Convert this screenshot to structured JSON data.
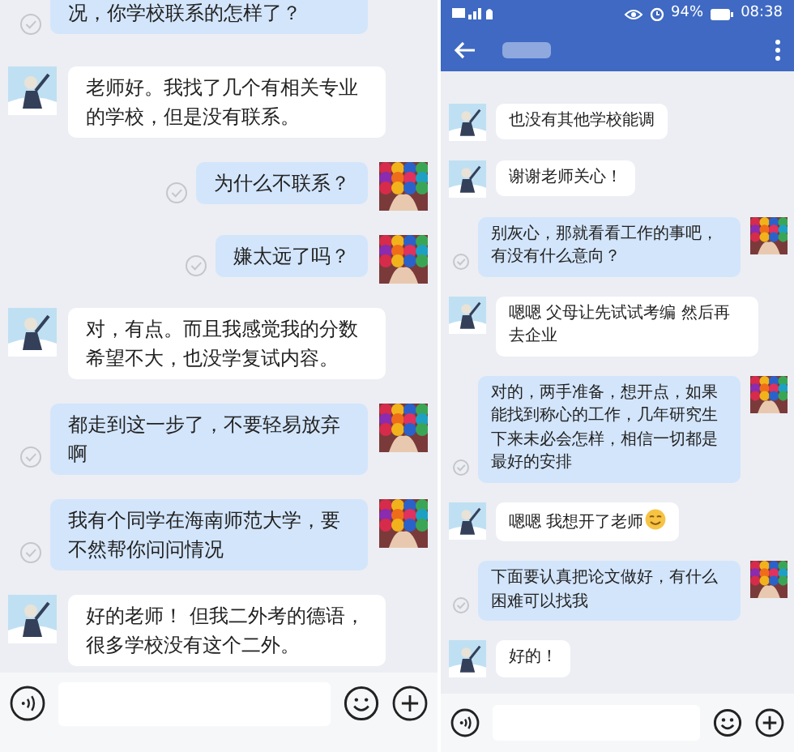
{
  "panels": [
    {
      "kind": "plain",
      "messages": [
        {
          "kind": "outgoing_cut",
          "read": true,
          "text": "况，你学校联系的怎样了？"
        },
        {
          "kind": "incoming",
          "read": false,
          "text": "老师好。我找了几个有相关专业的学校，但是没有联系。"
        },
        {
          "kind": "outgoing",
          "read": true,
          "text": "为什么不联系？"
        },
        {
          "kind": "outgoing",
          "read": true,
          "text": "嫌太远了吗？"
        },
        {
          "kind": "incoming",
          "read": false,
          "text": "对，有点。而且我感觉我的分数希望不大，也没学复试内容。"
        },
        {
          "kind": "outgoing",
          "read": true,
          "text": "都走到这一步了，不要轻易放弃啊"
        },
        {
          "kind": "outgoing",
          "read": true,
          "text": "我有个同学在海南师范大学，要不然帮你问问情况"
        },
        {
          "kind": "incoming",
          "read": false,
          "text": "好的老师！ 但我二外考的德语，很多学校没有这个二外。"
        }
      ]
    },
    {
      "kind": "header",
      "status_bar": {
        "battery": "94%",
        "time": "08:38"
      },
      "messages": [
        {
          "kind": "incoming",
          "read": false,
          "text": "也没有其他学校能调"
        },
        {
          "kind": "incoming",
          "read": false,
          "text": "谢谢老师关心！"
        },
        {
          "kind": "outgoing",
          "read": true,
          "text": "别灰心，那就看看工作的事吧，有没有什么意向？"
        },
        {
          "kind": "incoming",
          "read": false,
          "text": "嗯嗯 父母让先试试考编 然后再去企业"
        },
        {
          "kind": "outgoing",
          "read": true,
          "text": "对的，两手准备，想开点，如果能找到称心的工作，几年研究生下来未必会怎样，相信一切都是最好的安排"
        },
        {
          "kind": "incoming",
          "read": false,
          "text": "嗯嗯 我想开了老师",
          "emoji": true
        },
        {
          "kind": "outgoing",
          "read": true,
          "text": "下面要认真把论文做好，有什么困难可以找我"
        },
        {
          "kind": "incoming",
          "read": false,
          "text": "好的！"
        }
      ]
    }
  ]
}
